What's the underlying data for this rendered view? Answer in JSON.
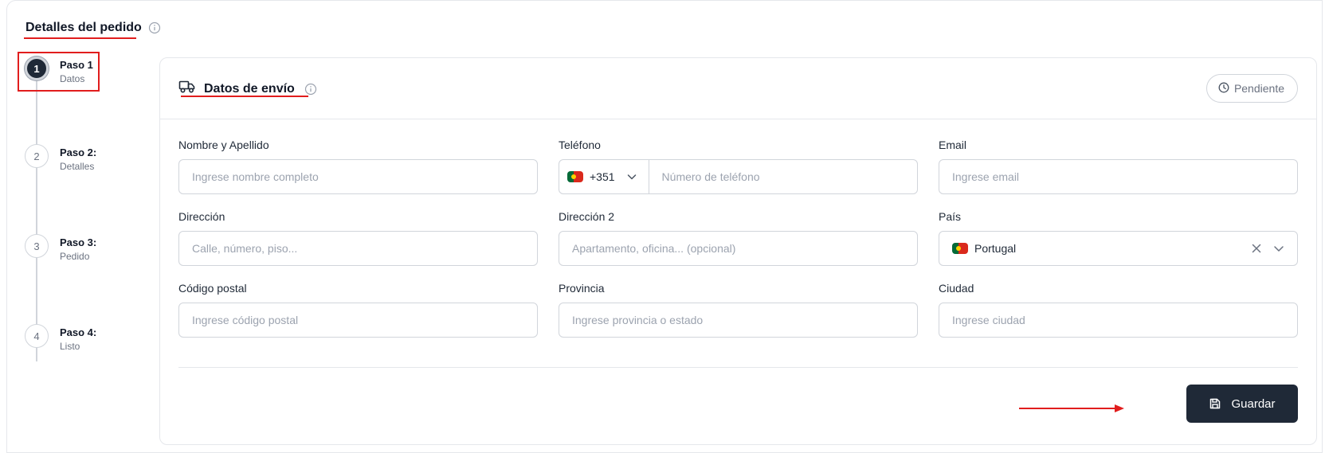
{
  "page": {
    "title": "Detalles del pedido"
  },
  "steps": [
    {
      "number": "1",
      "title": "Paso 1",
      "subtitle": "Datos"
    },
    {
      "number": "2",
      "title": "Paso 2:",
      "subtitle": "Detalles"
    },
    {
      "number": "3",
      "title": "Paso 3:",
      "subtitle": "Pedido"
    },
    {
      "number": "4",
      "title": "Paso 4:",
      "subtitle": "Listo"
    }
  ],
  "card": {
    "title": "Datos de envío",
    "status": "Pendiente"
  },
  "form": {
    "name": {
      "label": "Nombre y Apellido",
      "placeholder": "Ingrese nombre completo"
    },
    "phone": {
      "label": "Teléfono",
      "prefix": "+351",
      "placeholder": "Número de teléfono"
    },
    "email": {
      "label": "Email",
      "placeholder": "Ingrese email"
    },
    "address": {
      "label": "Dirección",
      "placeholder": "Calle, número, piso..."
    },
    "address2": {
      "label": "Dirección 2",
      "placeholder": "Apartamento, oficina... (opcional)"
    },
    "country": {
      "label": "País",
      "value": "Portugal"
    },
    "postal": {
      "label": "Código postal",
      "placeholder": "Ingrese código postal"
    },
    "province": {
      "label": "Provincia",
      "placeholder": "Ingrese provincia o estado"
    },
    "city": {
      "label": "Ciudad",
      "placeholder": "Ingrese ciudad"
    }
  },
  "actions": {
    "save_label": "Guardar"
  },
  "colors": {
    "primary": "#1f2937",
    "annotation": "#e11d1d",
    "border": "#d1d5db"
  }
}
